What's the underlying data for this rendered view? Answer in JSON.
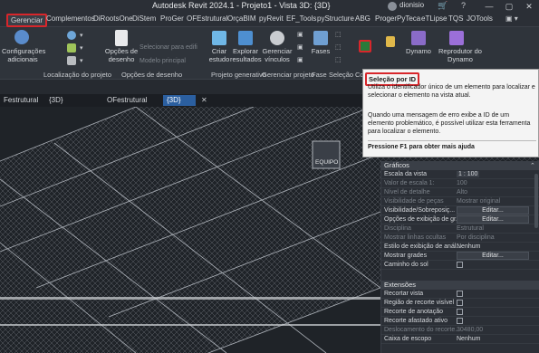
{
  "window": {
    "title": "Autodesk Revit 2024.1 - Projeto1 - Vista 3D: {3D}",
    "user": "dionisio"
  },
  "menubar": {
    "items": [
      "Gerenciar",
      "Complementos",
      "DiRootsOne",
      "DiStem",
      "ProGer",
      "OFEstrutural",
      "OrçaBIM",
      "pyRevit",
      "EF_Tools",
      "pyStructure",
      "ABG",
      "ProgerPyTeca",
      "eTLipse",
      "TQS",
      "JOTools"
    ]
  },
  "ribbon": {
    "config_label": "Configurações adicionais",
    "opcoes_desenho": "Opções de desenho",
    "selecionar_edificio": "Selecionar para edifi",
    "modelo_principal": "Modelo principal",
    "criar_estudo": "Criar estudo",
    "explorar_resultados": "Explorar resultados",
    "gerenciar_vinculos": "Gerenciar vínculos",
    "fases": "Fases",
    "dynamo": "Dynamo",
    "reprodutor_dynamo": "Reprodutor do Dynamo",
    "panels": {
      "localizacao": "Localização do projeto",
      "opcoes": "Opções de desenho",
      "projeto_gerativo": "Projeto generativo",
      "gerenciar_projeto": "Gerenciar projeto",
      "fase": "Fase",
      "selecao": "Seleção",
      "co": "Co"
    }
  },
  "tabs": {
    "t1": "Festrutural",
    "t2": "{3D}",
    "t3": "OFestrutural",
    "t4": "{3D}"
  },
  "viewport": {
    "label_equipo": "EQUIPO"
  },
  "tooltip": {
    "title": "Seleção por ID",
    "body1": "Utiliza o identificador único de um elemento para localizar e selecionar o elemento na vista atual.",
    "body2": "Quando uma mensagem de erro exibe a ID de um elemento problemático, é possível utilizar esta ferramenta para localizar o elemento.",
    "help": "Pressione F1 para obter mais ajuda"
  },
  "properties": {
    "sections": {
      "graficos": "Gráficos",
      "extensoes": "Extensões"
    },
    "rows": [
      {
        "name": "Escala da vista",
        "value": "1 : 100",
        "dim": false,
        "type": "text"
      },
      {
        "name": "Valor de escala    1:",
        "value": "100",
        "dim": true,
        "type": "text"
      },
      {
        "name": "Nível de detalhe",
        "value": "Alto",
        "dim": true,
        "type": "text"
      },
      {
        "name": "Visibilidade de peças",
        "value": "Mostrar original",
        "dim": true,
        "type": "text"
      },
      {
        "name": "Visibilidade/Sobreposiç...",
        "value": "Editar...",
        "dim": false,
        "type": "button"
      },
      {
        "name": "Opções de exibição de gr...",
        "value": "Editar...",
        "dim": false,
        "type": "button"
      },
      {
        "name": "Disciplina",
        "value": "Estrutural",
        "dim": true,
        "type": "text"
      },
      {
        "name": "Mostrar linhas ocultas",
        "value": "Por disciplina",
        "dim": true,
        "type": "text"
      },
      {
        "name": "Estilo de exibição de anál...",
        "value": "Nenhum",
        "dim": false,
        "type": "text"
      },
      {
        "name": "Mostrar grades",
        "value": "Editar...",
        "dim": false,
        "type": "button"
      },
      {
        "name": "Caminho do sol",
        "value": "",
        "dim": false,
        "type": "check"
      }
    ],
    "ext_rows": [
      {
        "name": "Recortar vista",
        "value": "",
        "dim": false,
        "type": "check"
      },
      {
        "name": "Região de recorte visível",
        "value": "",
        "dim": false,
        "type": "check"
      },
      {
        "name": "Recorte de anotação",
        "value": "",
        "dim": false,
        "type": "check"
      },
      {
        "name": "Recorte afastado ativo",
        "value": "",
        "dim": false,
        "type": "check"
      },
      {
        "name": "Deslocamento do recorte...",
        "value": "30480,00",
        "dim": true,
        "type": "text"
      },
      {
        "name": "Caixa de escopo",
        "value": "Nenhum",
        "dim": false,
        "type": "text"
      }
    ]
  }
}
